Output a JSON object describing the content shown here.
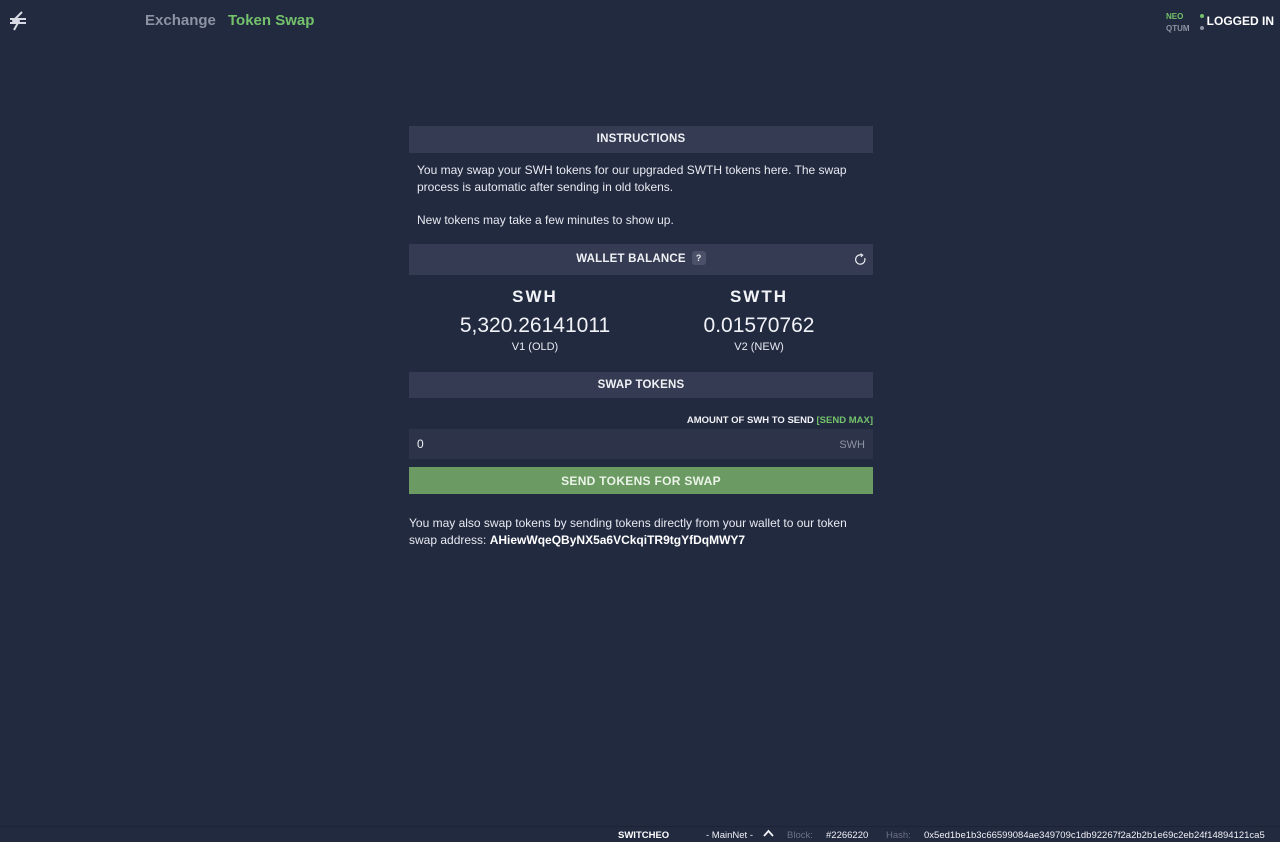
{
  "nav": {
    "exchange": "Exchange",
    "token_swap": "Token Swap",
    "chains": [
      {
        "name": "NEO",
        "status_color": "#74c26b"
      },
      {
        "name": "QTUM",
        "status_color": "#8d93a3"
      }
    ],
    "logged_in": "LOGGED IN"
  },
  "instructions": {
    "header": "INSTRUCTIONS",
    "text1": "You may swap your SWH tokens for our upgraded SWTH tokens here. The swap process is automatic after sending in old tokens.",
    "text2": "New tokens may take a few minutes to show up."
  },
  "wallet": {
    "header": "WALLET BALANCE",
    "help": "?",
    "old": {
      "symbol": "SWH",
      "amount": "5,320.26141011",
      "version": "V1 (OLD)"
    },
    "new": {
      "symbol": "SWTH",
      "amount": "0.01570762",
      "version": "V2 (NEW)"
    }
  },
  "swap": {
    "header": "SWAP TOKENS",
    "amount_label": "AMOUNT OF SWH TO SEND",
    "send_max": "[SEND MAX]",
    "amount_value": "0",
    "amount_unit": "SWH",
    "button": "SEND TOKENS FOR SWAP",
    "alt_text": "You may also swap tokens by sending tokens directly from your wallet to our token swap address:",
    "address": "AHiewWqeQByNX5a6VCkqiTR9tgYfDqMWY7"
  },
  "footer": {
    "brand": "SWITCHEO",
    "network": "- MainNet -",
    "block_label": "Block:",
    "block": "#2266220",
    "hash_label": "Hash:",
    "hash": "0x5ed1be1b3c66599084ae349709c1db92267f2a2b2b1e69c2eb24f14894121ca5"
  },
  "colors": {
    "background": "#222a40",
    "accent": "#74c26b",
    "button": "#6b9a62",
    "section_header": "#343b52"
  }
}
